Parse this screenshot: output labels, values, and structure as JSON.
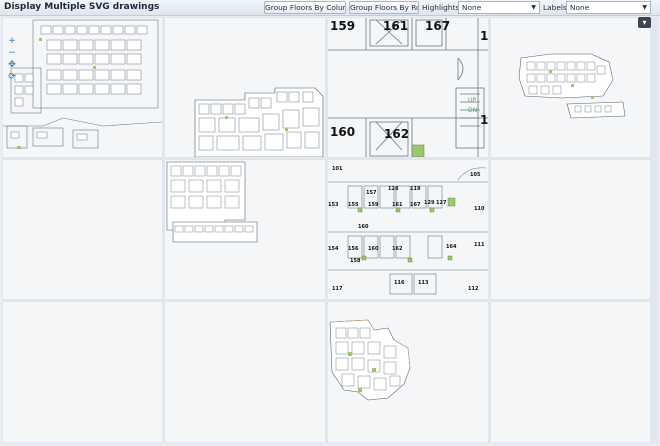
{
  "app": {
    "title": "Display Multiple SVG drawings"
  },
  "toolbar": {
    "group_by_column_label": "Group Floors By Column",
    "group_by_row_label": "Group Floors By Row",
    "highlights_label": "Highlights:",
    "highlights_value": "None",
    "labels_label": "Labels:",
    "labels_value": "None"
  },
  "icons": {
    "zoom_in": "plus-icon",
    "zoom_out": "minus-icon",
    "pan": "pan-icon",
    "reset": "reset-icon",
    "corner": "collapse-icon"
  },
  "top_right_panel": {
    "rooms_large": [
      "159",
      "161",
      "167",
      "1",
      "160",
      "162",
      "1"
    ],
    "labels_small": [
      "UP",
      "DN"
    ]
  },
  "middle_panel": {
    "rooms": [
      "101",
      "157",
      "128",
      "119",
      "105",
      "153",
      "155",
      "159",
      "161",
      "167",
      "129",
      "127",
      "110",
      "160",
      "154",
      "156",
      "160",
      "162",
      "164",
      "111",
      "158",
      "116",
      "113",
      "112",
      "117"
    ]
  },
  "colors": {
    "accent_green": "#4caf50",
    "plan_line": "#6b7784",
    "panel_bg": "#f4f6f8",
    "door_green": "#9cc76f"
  }
}
